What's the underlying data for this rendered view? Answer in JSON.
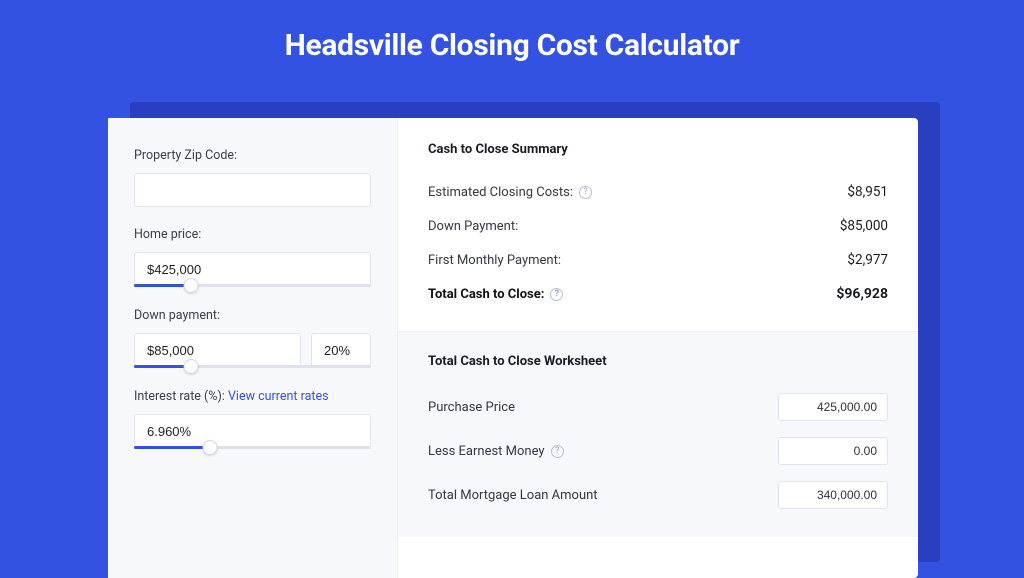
{
  "page": {
    "title": "Headsville Closing Cost Calculator"
  },
  "form": {
    "zip": {
      "label": "Property Zip Code:",
      "value": ""
    },
    "home_price": {
      "label": "Home price:",
      "value": "$425,000",
      "slider_pct": 24
    },
    "down_payment": {
      "label": "Down payment:",
      "value": "$85,000",
      "pct_value": "20%",
      "slider_pct": 24
    },
    "interest_rate": {
      "label": "Interest rate (%):",
      "link_text": "View current rates",
      "value": "6.960%",
      "slider_pct": 32
    }
  },
  "summary": {
    "title": "Cash to Close Summary",
    "rows": [
      {
        "label": "Estimated Closing Costs:",
        "value": "$8,951",
        "help": true
      },
      {
        "label": "Down Payment:",
        "value": "$85,000",
        "help": false
      },
      {
        "label": "First Monthly Payment:",
        "value": "$2,977",
        "help": false
      }
    ],
    "total": {
      "label": "Total Cash to Close:",
      "value": "$96,928",
      "help": true
    }
  },
  "worksheet": {
    "title": "Total Cash to Close Worksheet",
    "rows": [
      {
        "label": "Purchase Price",
        "value": "425,000.00",
        "help": false
      },
      {
        "label": "Less Earnest Money",
        "value": "0.00",
        "help": true
      },
      {
        "label": "Total Mortgage Loan Amount",
        "value": "340,000.00",
        "help": false
      }
    ]
  }
}
